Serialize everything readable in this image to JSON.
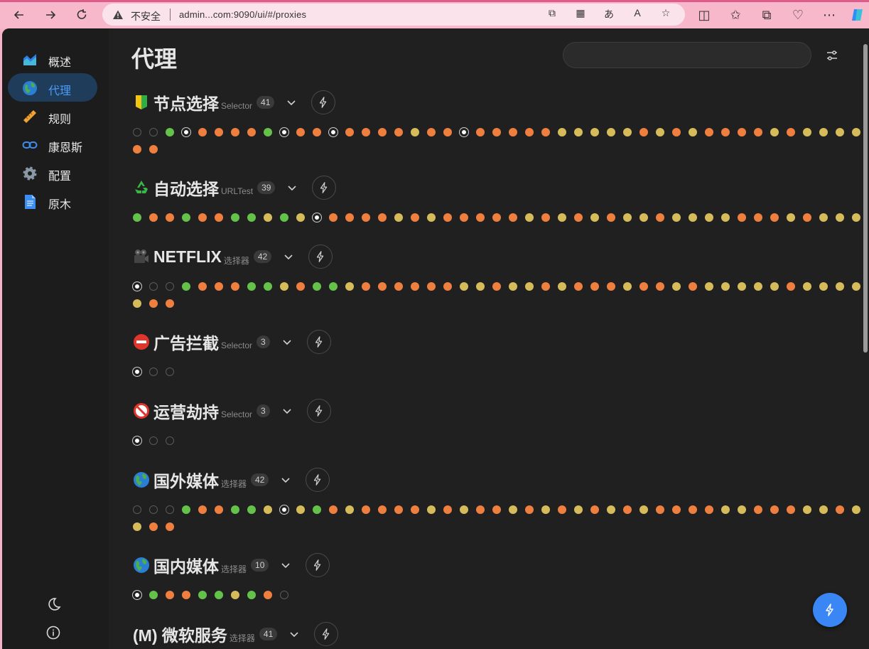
{
  "browser": {
    "security_label": "不安全",
    "url": "admin...com:9090/ui/#/proxies",
    "icons": [
      "back-icon",
      "forward-icon",
      "refresh-icon",
      "warning-icon",
      "app-available-icon",
      "apps-icon",
      "translate-icon",
      "read-aloud-icon",
      "favorite-star-icon",
      "split-screen-icon",
      "favorites-icon",
      "collections-icon",
      "performance-icon",
      "more-icon",
      "copilot-icon"
    ]
  },
  "sidebar": {
    "items": [
      {
        "label": "概述",
        "icon": "chart-icon",
        "active": false
      },
      {
        "label": "代理",
        "icon": "globe-icon",
        "active": true
      },
      {
        "label": "规则",
        "icon": "ruler-icon",
        "active": false
      },
      {
        "label": "康恩斯",
        "icon": "link-icon",
        "active": false
      },
      {
        "label": "配置",
        "icon": "gear-icon",
        "active": false
      },
      {
        "label": "原木",
        "icon": "document-icon",
        "active": false
      }
    ]
  },
  "main": {
    "title": "代理",
    "search": {
      "value": "",
      "placeholder": ""
    }
  },
  "groups": [
    {
      "name": "节点选择",
      "type": "Selector",
      "count": "41",
      "emoji": "beginner",
      "rows": [
        "0014333314334333323343333322222323233332322222323",
        "33"
      ]
    },
    {
      "name": "自动选择",
      "type": "URLTest",
      "count": "39",
      "emoji": "recycle",
      "rows": [
        "13313311212433332323333323232322322223332322223333"
      ]
    },
    {
      "name": "NETFLIX",
      "type": "选择器",
      "count": "42",
      "emoji": "camera",
      "rows": [
        "4001333112311233333322322323332332322222322223232",
        "233"
      ]
    },
    {
      "name": "广告拦截",
      "type": "Selector",
      "count": "3",
      "emoji": "no-entry",
      "rows": [
        "400"
      ]
    },
    {
      "name": "运营劫持",
      "type": "Selector",
      "count": "3",
      "emoji": "prohibited",
      "rows": [
        "400"
      ]
    },
    {
      "name": "国外媒体",
      "type": "选择器",
      "count": "42",
      "emoji": "globe",
      "rows": [
        "0001331124213233332323323232323233332233322322323",
        "233"
      ]
    },
    {
      "name": "国内媒体",
      "type": "选择器",
      "count": "10",
      "emoji": "globe",
      "rows": [
        "4133112130"
      ]
    },
    {
      "name": "(M) 微软服务",
      "type": "选择器",
      "count": "41",
      "emoji": "",
      "rows": []
    }
  ]
}
